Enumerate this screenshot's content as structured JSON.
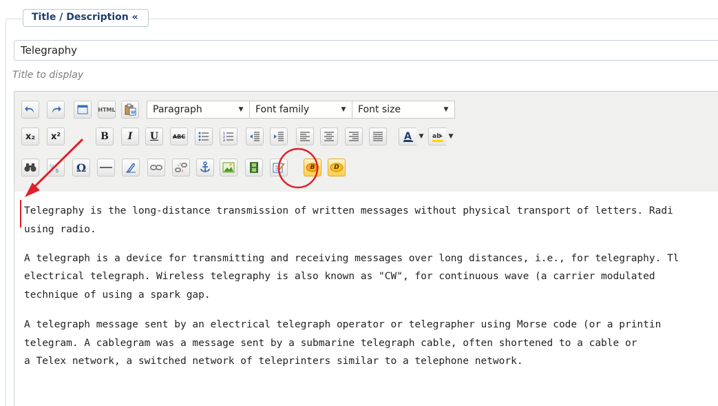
{
  "fieldset": {
    "legend": "Title / Description «"
  },
  "title_field": {
    "value": "Telegraphy",
    "hint": "Title to display"
  },
  "toolbar": {
    "row1": {
      "undo_icon": "undo-icon",
      "redo_icon": "redo-icon",
      "html_label": "HTML",
      "format_select": "Paragraph",
      "font_family_select": "Font family",
      "font_size_select": "Font size"
    },
    "row2": {
      "subscript_label": "x₂",
      "superscript_label": "x²",
      "bold_label": "B",
      "italic_label": "I",
      "underline_label": "U",
      "strike_label": "ABC"
    },
    "row3": {
      "omega_label": "Ω",
      "b_badge": "B",
      "d_badge": "D"
    },
    "highlight_color": "#e0202a"
  },
  "content": {
    "lines": [
      "Telegraphy is the long-distance transmission of written messages without physical transport of letters. Radi",
      "using radio.",
      "A telegraph is a device for transmitting and receiving messages over long distances, i.e., for telegraphy. Tl",
      "electrical telegraph. Wireless telegraphy is also known as \"CW\", for continuous wave (a carrier modulated",
      "technique of using a spark gap.",
      "A telegraph message sent by an electrical telegraph operator or telegrapher using Morse code (or a printin",
      "telegram. A cablegram was a message sent by a submarine telegraph cable, often shortened to a cable or",
      "a Telex network, a switched network of teleprinters similar to a telephone network."
    ]
  }
}
